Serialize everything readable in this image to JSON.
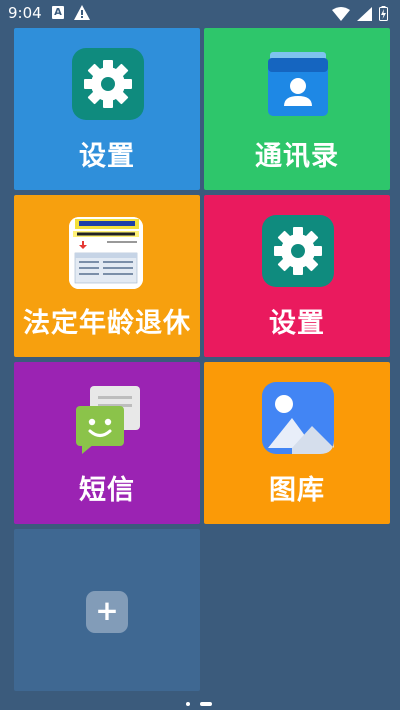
{
  "status_bar": {
    "time": "9:04",
    "notification_letter": "A"
  },
  "tiles": [
    {
      "label": "设置",
      "icon": "settings-gear-icon",
      "color": "#2f8fda"
    },
    {
      "label": "通讯录",
      "icon": "contacts-icon",
      "color": "#2ec66b"
    },
    {
      "label": "法定年龄退休",
      "icon": "app-thumbnail",
      "color": "#f7a00e"
    },
    {
      "label": "设置",
      "icon": "settings-gear-icon",
      "color": "#ea1a5e"
    },
    {
      "label": "短信",
      "icon": "messages-icon",
      "color": "#9b23b3"
    },
    {
      "label": "图库",
      "icon": "gallery-icon",
      "color": "#fb9a07"
    }
  ],
  "add_tile": {
    "label": "+",
    "icon": "plus-icon",
    "color": "#3f6892"
  },
  "background": "#3b5b7c",
  "page_indicator": {
    "pages": 2,
    "current": 2
  }
}
